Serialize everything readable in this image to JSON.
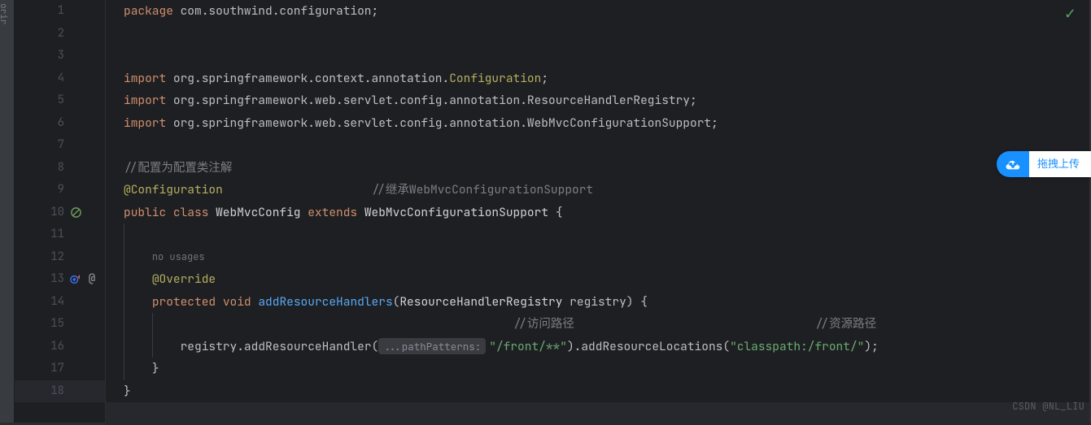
{
  "leftStub": "orir",
  "lineNumbers": [
    "1",
    "2",
    "3",
    "4",
    "5",
    "6",
    "7",
    "8",
    "9",
    "10",
    "11",
    "12",
    "13",
    "14",
    "15",
    "16",
    "17",
    "18"
  ],
  "pkgKw": "package",
  "pkgName": "com.southwind.configuration",
  "semi": ";",
  "importKw": "import",
  "import1": "org.springframework.context.annotation.",
  "import1b": "Configuration",
  "import2": "org.springframework.web.servlet.config.annotation.ResourceHandlerRegistry",
  "import3": "org.springframework.web.servlet.config.annotation.WebMvcConfigurationSupport",
  "comment1": "//配置为配置类注解",
  "comment2": "//继承WebMvcConfigurationSupport",
  "atCfg": "@Configuration",
  "publicKw": "public",
  "classKw": "class",
  "className": "WebMvcConfig",
  "extendsKw": "extends",
  "superClass": "WebMvcConfigurationSupport",
  "openBrace": "{",
  "closeBrace": "}",
  "noUsages": "no usages",
  "override": "@Override",
  "protectedKw": "protected",
  "voidKw": "void",
  "methodName": "addResourceHandlers",
  "paramType": "ResourceHandlerRegistry",
  "paramName": "registry",
  "closeParen": ")",
  "openParen": "(",
  "commentPath": "//访问路径",
  "commentRes": "//资源路径",
  "regVar": "registry",
  "dot": ".",
  "addResH": "addResourceHandler",
  "pathHint": "...pathPatterns:",
  "pathStr": "\"/front/**\"",
  "addResL": "addResourceLocations",
  "locStr": "\"classpath:/front/\"",
  "watermark": "CSDN @NL_LIU",
  "uploadText": "拖拽上传",
  "checkMark": "✓"
}
